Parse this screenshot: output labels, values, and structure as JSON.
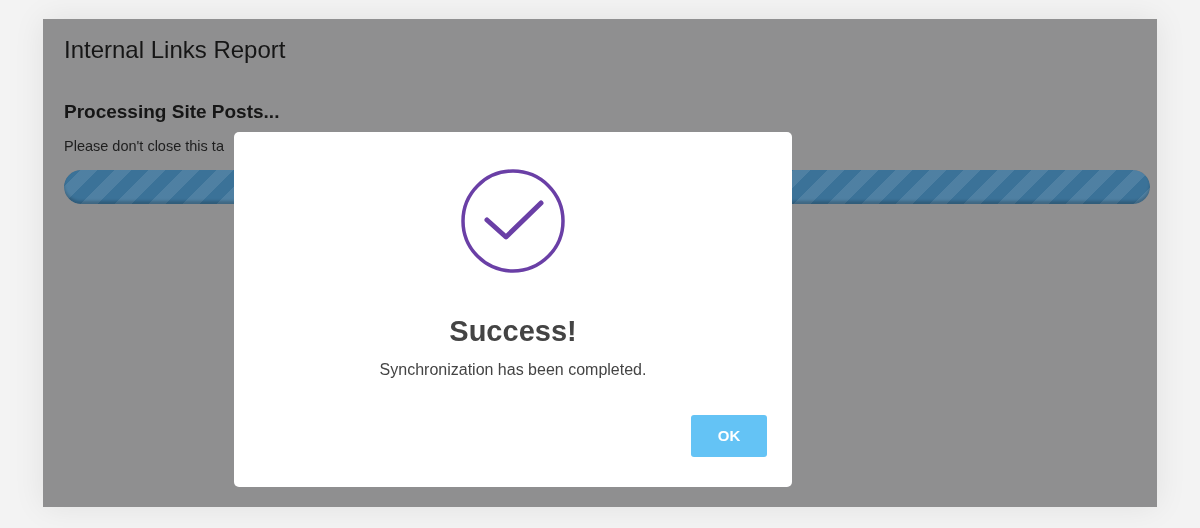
{
  "page": {
    "title": "Internal Links Report",
    "heading": "Processing Site Posts...",
    "notice": "Please don't close this ta",
    "progress": {
      "level": 1
    }
  },
  "dialog": {
    "title": "Success!",
    "message": "Synchronization has been completed.",
    "button": "OK"
  }
}
